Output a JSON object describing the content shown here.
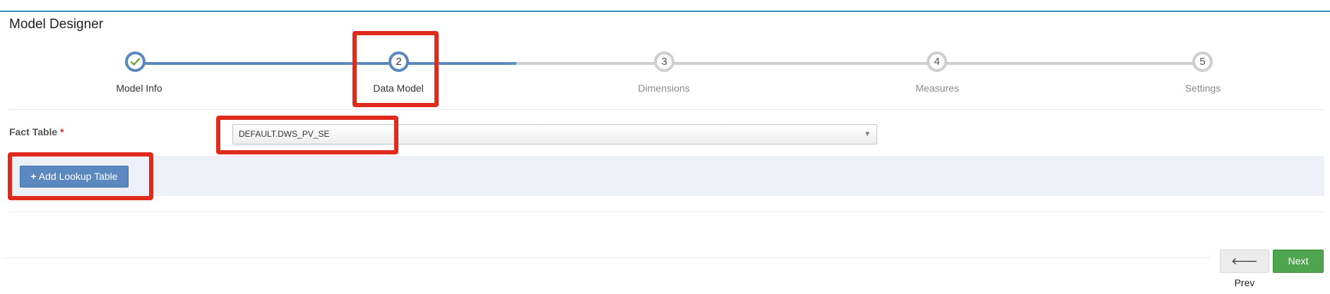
{
  "header": {
    "title": "Model Designer"
  },
  "wizard": {
    "steps": [
      {
        "number": "",
        "label": "Model Info",
        "state": "done",
        "icon": "check-icon"
      },
      {
        "number": "2",
        "label": "Data Model",
        "state": "active"
      },
      {
        "number": "3",
        "label": "Dimensions",
        "state": "todo"
      },
      {
        "number": "4",
        "label": "Measures",
        "state": "todo"
      },
      {
        "number": "5",
        "label": "Settings",
        "state": "todo"
      }
    ]
  },
  "form": {
    "fact_table_label": "Fact Table",
    "required_marker": "*",
    "fact_table_value": "DEFAULT.DWS_PV_SE"
  },
  "lookup": {
    "add_button_icon": "+",
    "add_button_label": "Add Lookup Table"
  },
  "footer": {
    "prev_label": "Prev",
    "next_label": "Next",
    "prev_icon": "🡐",
    "next_icon": "🡒"
  },
  "colors": {
    "accent": "#5b88bf",
    "success": "#4fa44f",
    "highlight": "#e02a1c",
    "inactive": "#cfcfcf"
  }
}
